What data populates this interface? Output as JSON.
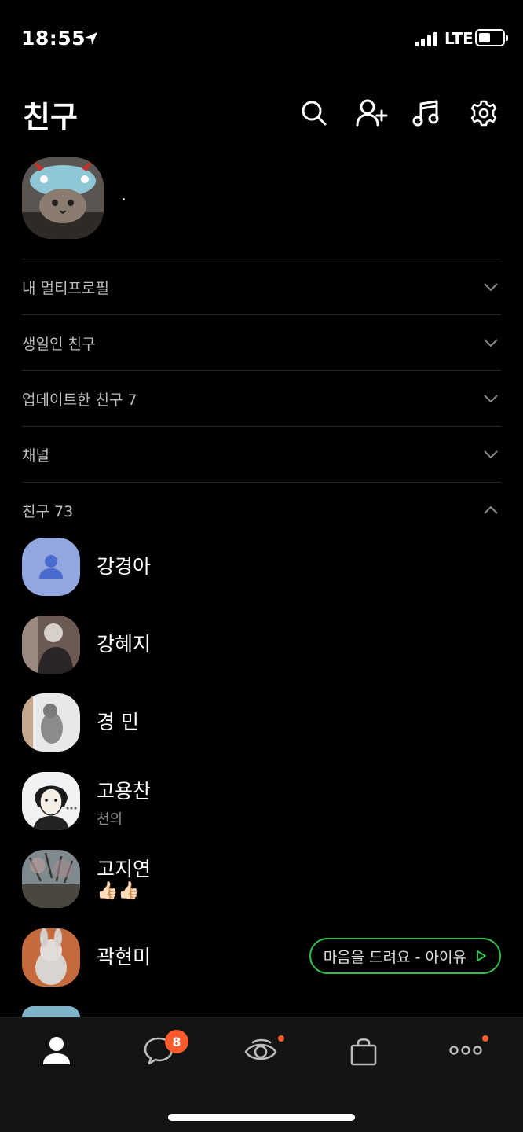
{
  "status_bar": {
    "time": "18:55",
    "network": "LTE"
  },
  "header": {
    "title": "친구"
  },
  "my_profile": {
    "name": "."
  },
  "sections": [
    {
      "label": "내 멀티프로필",
      "expanded": false
    },
    {
      "label": "생일인 친구",
      "expanded": false
    },
    {
      "label": "업데이트한 친구 7",
      "expanded": false
    },
    {
      "label": "채널",
      "expanded": false
    },
    {
      "label": "친구 73",
      "expanded": true
    }
  ],
  "friends": [
    {
      "name": "강경아",
      "status": ""
    },
    {
      "name": "강혜지",
      "status": ""
    },
    {
      "name": "경 민",
      "status": ""
    },
    {
      "name": "고용찬",
      "status": "천의"
    },
    {
      "name": "고지연",
      "status": "👍🏻👍🏻"
    },
    {
      "name": "곽현미",
      "status": "",
      "music": "마음을 드려요 - 아이유"
    }
  ],
  "bottom_nav": {
    "chat_badge": "8",
    "tabs": [
      "friends",
      "chats",
      "view",
      "shopping",
      "more"
    ]
  },
  "colors": {
    "background": "#000000",
    "accent_green": "#2fbf4d",
    "badge_orange": "#ff5a2c"
  }
}
